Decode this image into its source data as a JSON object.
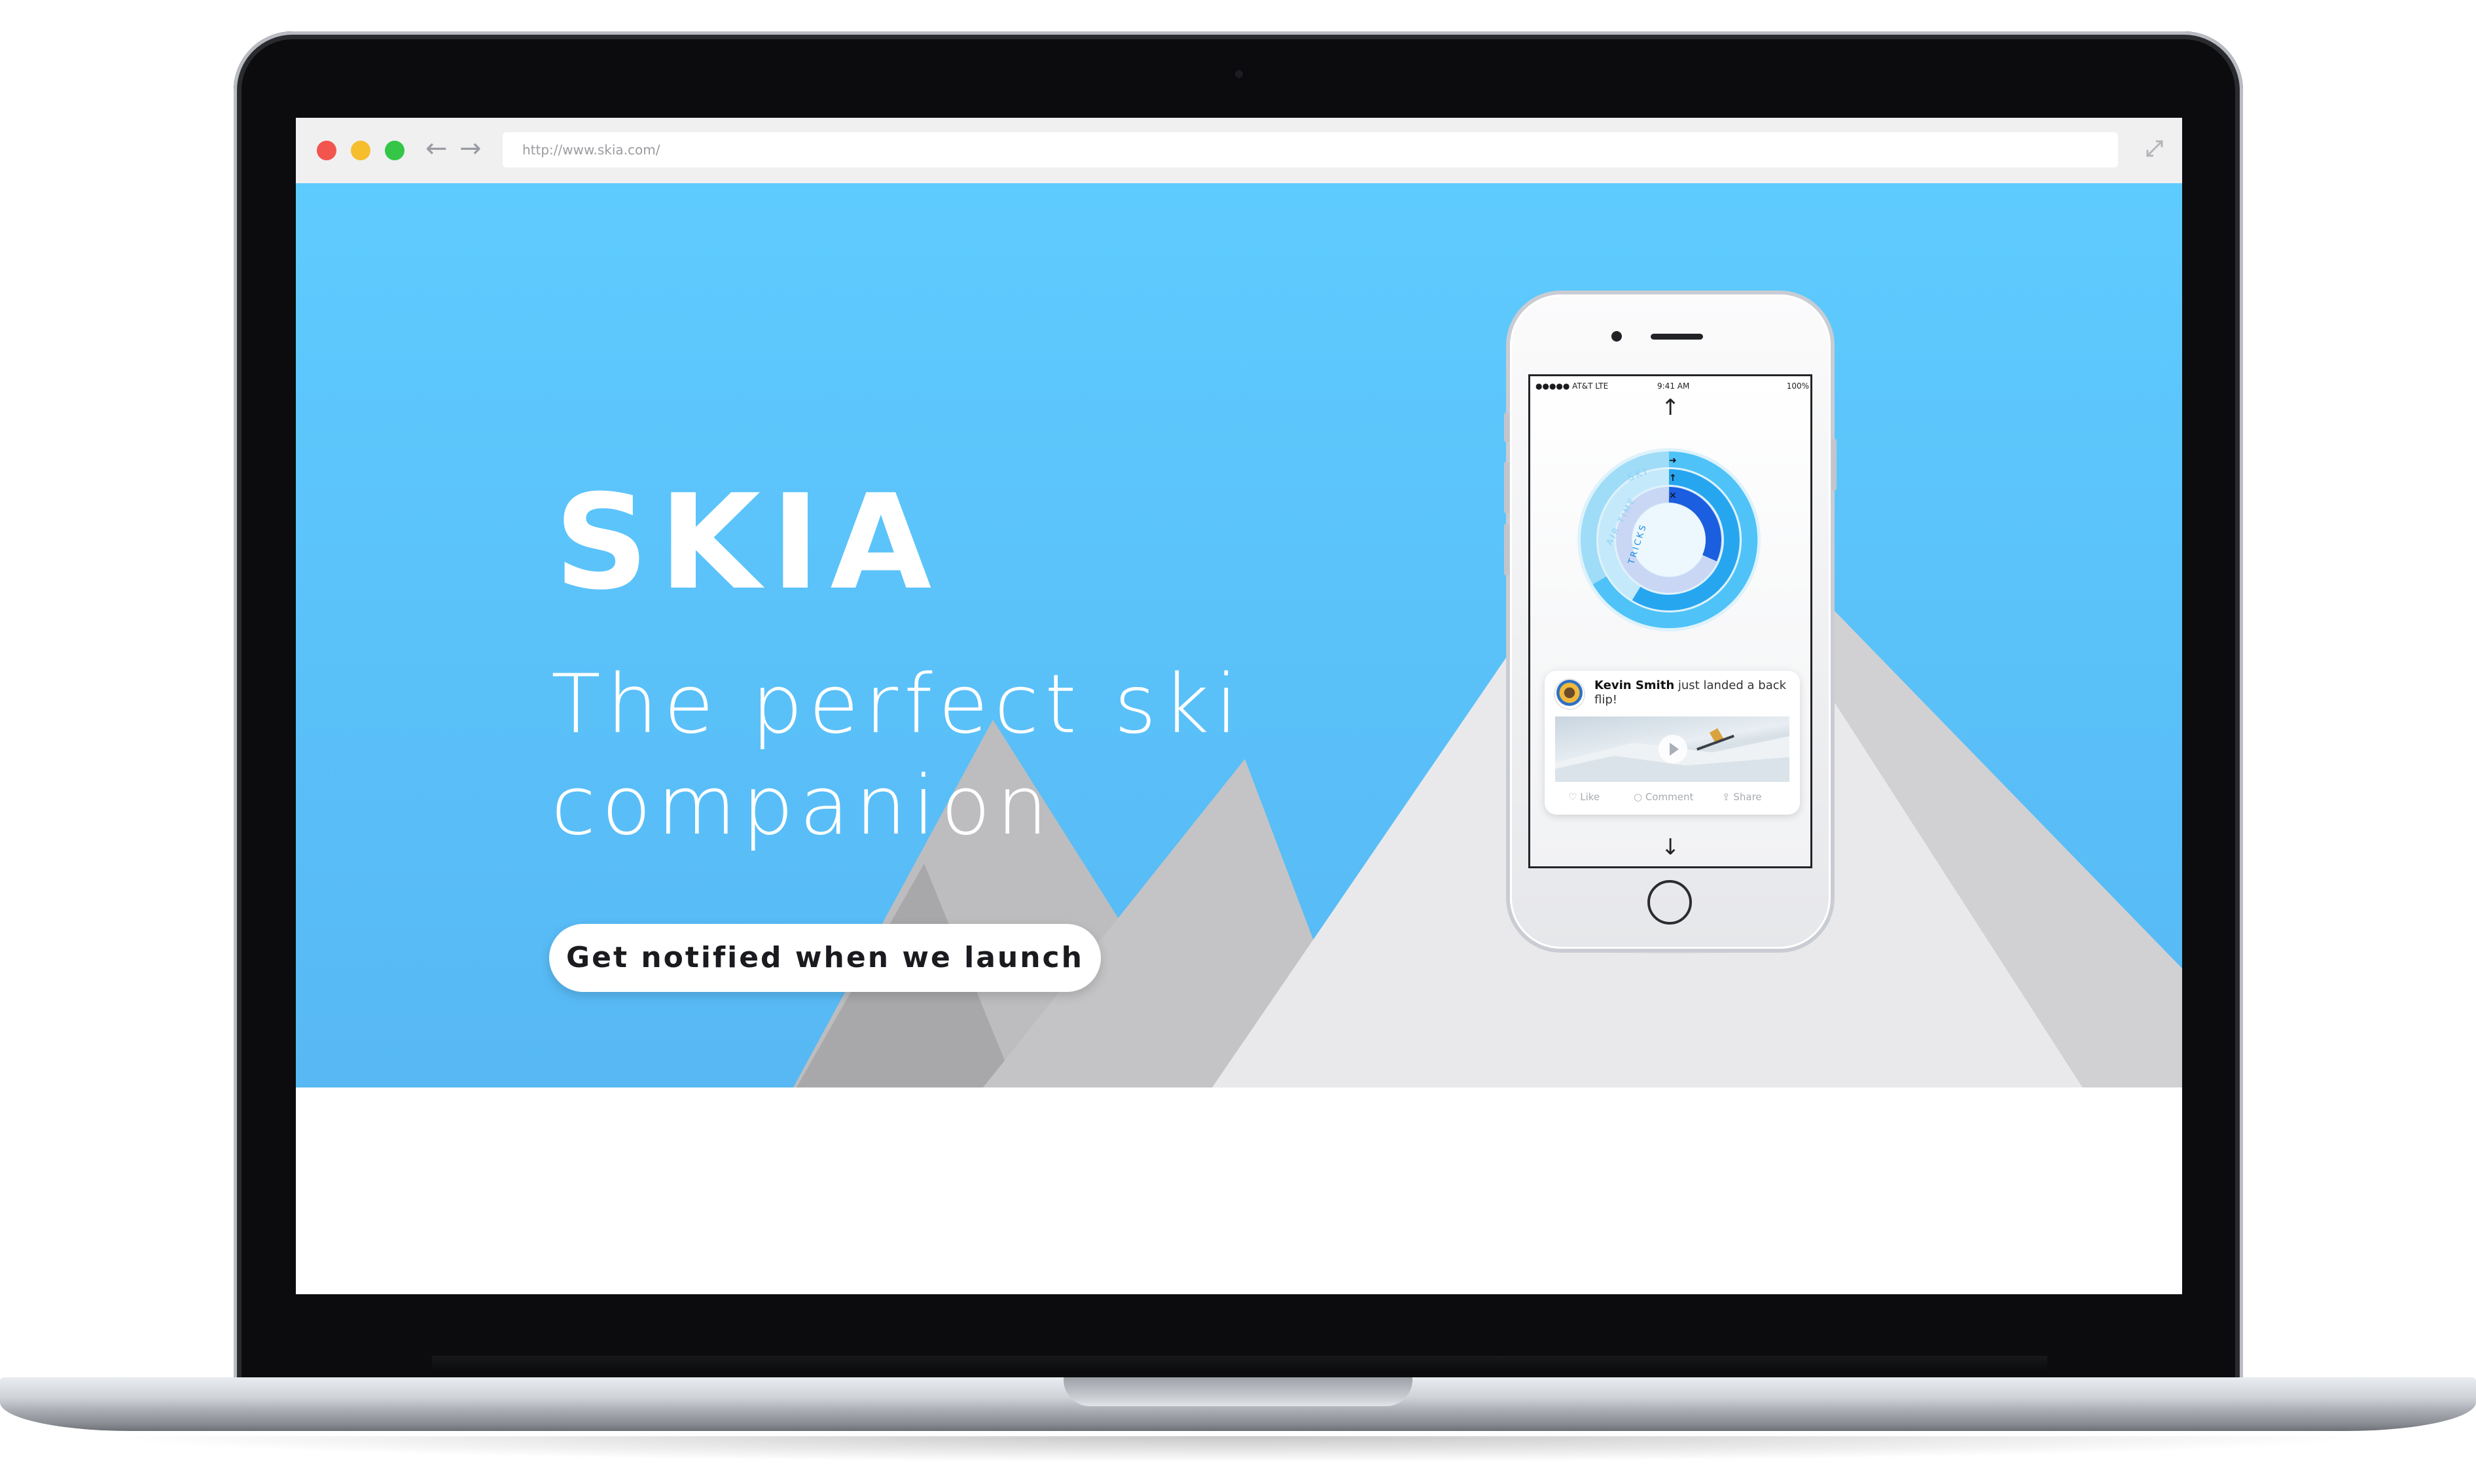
{
  "browser": {
    "url": "http://www.skia.com/"
  },
  "hero": {
    "logo": "SKIA",
    "tagline_line1": "The perfect ski",
    "tagline_line2": "companion",
    "cta_label": "Get notified when we launch"
  },
  "phone": {
    "status": {
      "carrier": "●●●●● AT&T  LTE",
      "time": "9:41 AM",
      "battery": "100%"
    },
    "rings": {
      "labels": [
        "SKI",
        "AIR TIME",
        "TRICKS"
      ]
    },
    "notification": {
      "name": "Kevin Smith",
      "message": "just landed a back flip!",
      "actions": [
        "Like",
        "Comment",
        "Share"
      ]
    }
  },
  "colors": {
    "sky_top": "#5ecbfe",
    "sky_bottom": "#57b8f4",
    "mountain_dark": "#a9a9ab",
    "mountain_mid": "#c6c6c8",
    "mountain_light": "#e6e6e8",
    "ring_blue": "#1c5ee0"
  }
}
